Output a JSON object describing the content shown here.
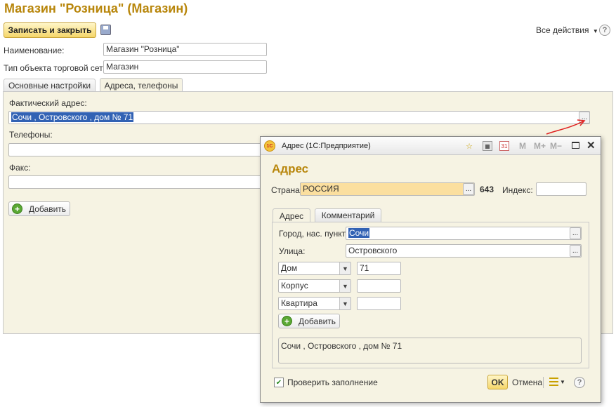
{
  "page": {
    "title": "Магазин \"Розница\" (Магазин)",
    "save_close_label": "Записать и закрыть",
    "all_actions_label": "Все действия",
    "help_glyph": "?"
  },
  "fields": {
    "name_label": "Наименование:",
    "name_value": "Магазин \"Розница\"",
    "type_label": "Тип объекта торговой сети:",
    "type_value": "Магазин"
  },
  "tabs": [
    {
      "label": "Основные настройки",
      "active": false
    },
    {
      "label": "Адреса, телефоны",
      "active": true
    }
  ],
  "address_tab": {
    "actual_address_label": "Фактический адрес:",
    "actual_address_value": "Сочи , Островского , дом № 71",
    "phones_label": "Телефоны:",
    "fax_label": "Факс:",
    "add_label": "Добавить"
  },
  "dialog": {
    "window_title": "Адрес  (1С:Предприятие)",
    "logo_text": "1С",
    "toolbar_m": "M",
    "toolbar_mplus": "M+",
    "toolbar_mminus": "M−",
    "heading": "Адрес",
    "country_label": "Страна:",
    "country_value": "РОССИЯ",
    "country_code": "643",
    "index_label": "Индекс:",
    "index_value": "",
    "tabs": [
      {
        "label": "Адрес",
        "active": true
      },
      {
        "label": "Комментарий",
        "active": false
      }
    ],
    "city_label": "Город, нас. пункт:",
    "city_value": "Сочи",
    "street_label": "Улица:",
    "street_value": "Островского",
    "house_type": "Дом",
    "house_value": "71",
    "building_type": "Корпус",
    "building_value": "",
    "apartment_type": "Квартира",
    "apartment_value": "",
    "add_label": "Добавить",
    "full_address": "Сочи , Островского , дом № 71",
    "check_label": "Проверить заполнение",
    "ok_label": "OK",
    "cancel_label": "Отмена"
  },
  "colors": {
    "title": "#b8860b",
    "panel_bg": "#f6f3e3",
    "selection": "#3262b4",
    "country_bg": "#fbdf9f",
    "annotation_arrow": "#e02020"
  }
}
